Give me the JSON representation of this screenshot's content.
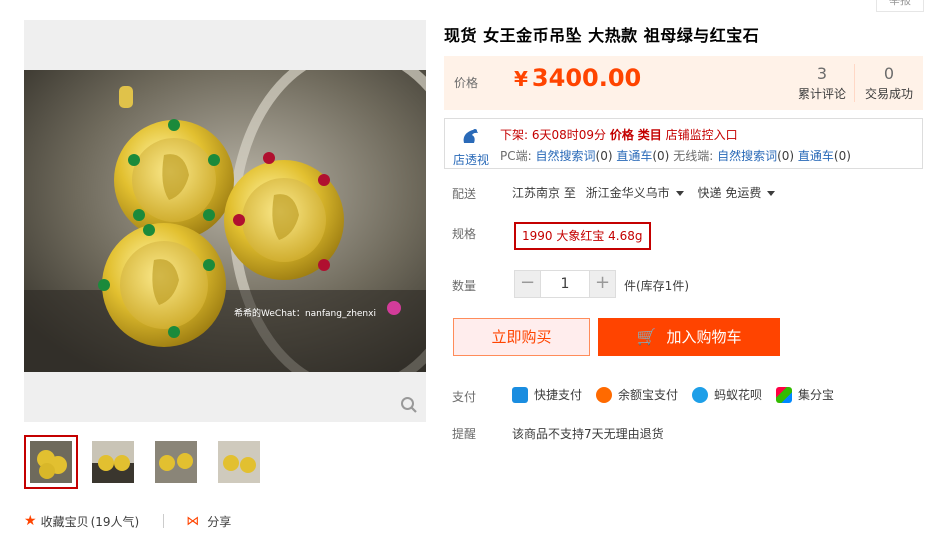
{
  "report_label": "举报",
  "title": "现货 女王金币吊坠 大热款 祖母绿与红宝石",
  "price": {
    "label": "价格",
    "currency": "¥",
    "amount": "3400.00"
  },
  "stats": [
    {
      "value": "3",
      "label": "累计评论"
    },
    {
      "value": "0",
      "label": "交易成功"
    }
  ],
  "monitor": {
    "logo_text": "店透视",
    "row1": {
      "prefix": "下架:",
      "time": "6天08时09分",
      "price_link": "价格",
      "category_link": "类目",
      "monitor_link": "店铺监控入口"
    },
    "row2": {
      "pc_label": "PC端:",
      "organic_label": "自然搜索词",
      "organic_pc": "(0)",
      "express_label": "直通车",
      "express_pc": "(0)",
      "wireless_label": "无线端:",
      "organic_label2": "自然搜索词",
      "organic_wl": "(0)",
      "express_label2": "直通车",
      "express_wl": "(0)"
    }
  },
  "shipping": {
    "label": "配送",
    "from": "江苏南京 至",
    "to": "浙江金华义乌市",
    "method": "快递 免运费"
  },
  "spec": {
    "label": "规格",
    "selected": "1990 大象红宝 4.68g"
  },
  "quantity": {
    "label": "数量",
    "value": "1",
    "minus": "−",
    "plus": "+",
    "stock": "件(库存1件)"
  },
  "actions": {
    "buy_now": "立即购买",
    "add_cart": "加入购物车"
  },
  "payment": {
    "label": "支付",
    "methods": [
      "快捷支付",
      "余额宝支付",
      "蚂蚁花呗",
      "集分宝"
    ]
  },
  "notice": {
    "label": "提醒",
    "text": "该商品不支持7天无理由退货"
  },
  "photo_watermark": "希希的WeChat：nanfang_zhenxi",
  "social": {
    "favorite": "收藏宝贝",
    "popularity": "(19人气)",
    "share": "分享"
  },
  "colors": {
    "accent": "#ff4400",
    "price": "#ff4400",
    "price_bg": "#fff2e8",
    "link_blue": "#2a6ab8",
    "spec_red": "#c40000"
  }
}
